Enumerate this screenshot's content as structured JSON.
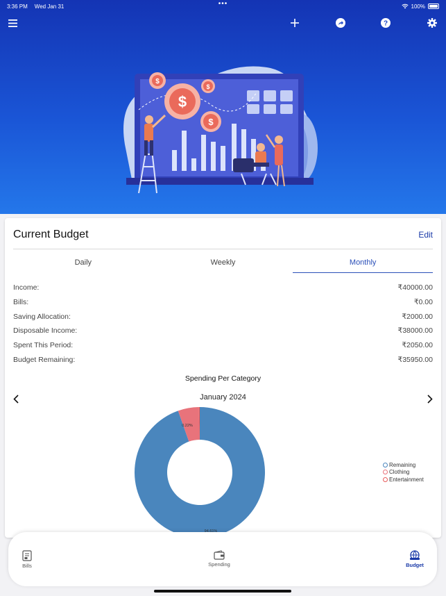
{
  "status_bar": {
    "time": "3:36 PM",
    "date": "Wed Jan 31",
    "battery": "100%"
  },
  "nav_icons": [
    "menu-icon",
    "plus-icon",
    "share-arrow-icon",
    "help-icon",
    "gear-icon"
  ],
  "colors": {
    "header_top": "#1434b4",
    "header_bottom": "#2477ea",
    "accent": "#1a3aa8",
    "remaining": "#4a86bd",
    "clothing": "#e8737b"
  },
  "budget": {
    "title": "Current Budget",
    "edit_label": "Edit",
    "tabs": [
      {
        "label": "Daily",
        "active": false
      },
      {
        "label": "Weekly",
        "active": false
      },
      {
        "label": "Monthly",
        "active": true
      }
    ],
    "rows": [
      {
        "label": "Income:",
        "value": "₹40000.00"
      },
      {
        "label": "Bills:",
        "value": "₹0.00"
      },
      {
        "label": "Saving Allocation:",
        "value": "₹2000.00"
      },
      {
        "label": "Disposable Income:",
        "value": "₹38000.00"
      },
      {
        "label": "Spent This Period:",
        "value": "₹2050.00"
      },
      {
        "label": "Budget Remaining:",
        "value": "₹35950.00"
      }
    ]
  },
  "spending": {
    "title": "Spending Per Category",
    "month": "January 2024",
    "slice_labels": {
      "clothing": "0.22%",
      "remaining": "94.61%"
    }
  },
  "chart_data": {
    "type": "pie",
    "title": "Spending Per Category",
    "categories": [
      "Remaining",
      "Clothing",
      "Entertainment"
    ],
    "values": [
      94.61,
      5.17,
      0.22
    ],
    "legend_position": "right"
  },
  "legend": [
    {
      "label": "Remaining",
      "color": "#4a86bd"
    },
    {
      "label": "Clothing",
      "color": "#e8737b"
    },
    {
      "label": "Entertainment",
      "color": "#e85a5a"
    }
  ],
  "bottom_tabs": [
    {
      "label": "Bills",
      "icon": "bills-icon",
      "active": false
    },
    {
      "label": "Spending",
      "icon": "wallet-icon",
      "active": false
    },
    {
      "label": "Budget",
      "icon": "budget-globe-icon",
      "active": true
    }
  ]
}
